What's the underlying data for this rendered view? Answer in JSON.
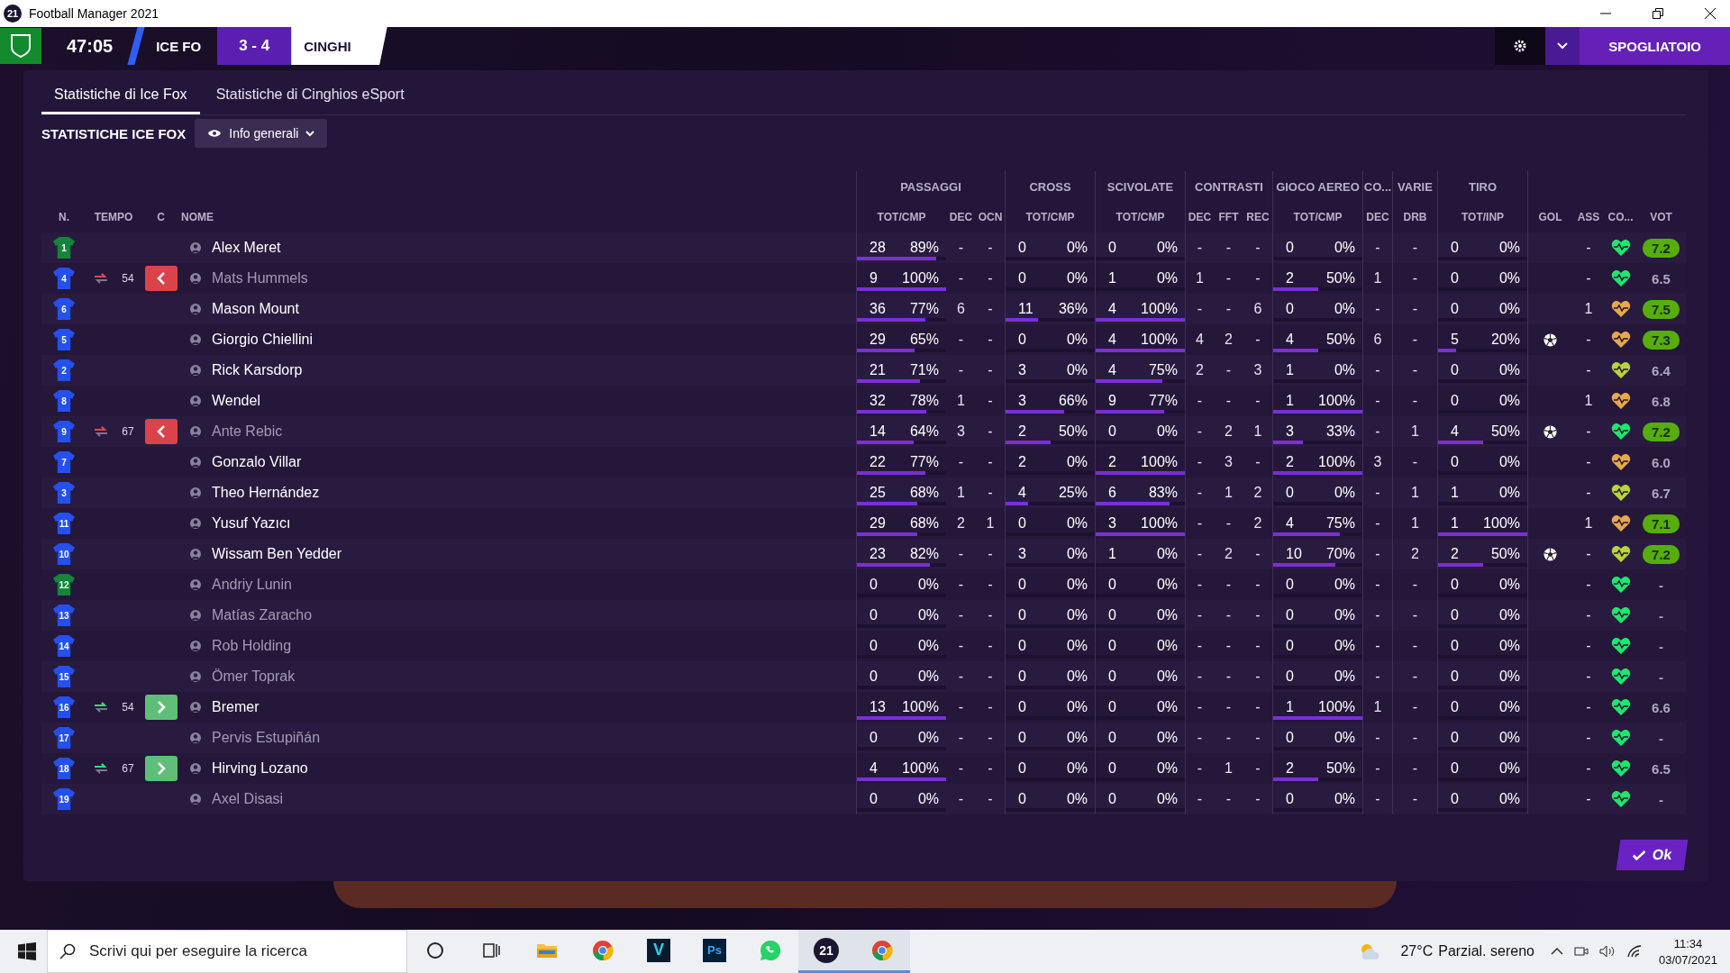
{
  "window": {
    "title": "Football Manager 2021",
    "logo": "21"
  },
  "match_bar": {
    "clock": "47:05",
    "home": "ICE FO",
    "score": "3 - 4",
    "away": "CINGHI",
    "button": "SPOGLIATOIO"
  },
  "tabs": [
    {
      "label": "Statistiche di Ice Fox",
      "selected": true
    },
    {
      "label": "Statistiche di Cinghios eSport",
      "selected": false
    }
  ],
  "section_title": "STATISTICHE ICE FOX",
  "view_dropdown": {
    "value": "Info generali"
  },
  "table": {
    "leading_columns": [
      "N.",
      "TEMPO",
      "C",
      "NOME"
    ],
    "groups": [
      {
        "label": "PASSAGGI",
        "columns": [
          "TOT/CMP",
          "DEC",
          "OCN"
        ]
      },
      {
        "label": "CROSS",
        "columns": [
          "TOT/CMP"
        ]
      },
      {
        "label": "SCIVOLATE",
        "columns": [
          "TOT/CMP"
        ]
      },
      {
        "label": "CONTRASTI",
        "columns": [
          "DEC",
          "FFT",
          "REC"
        ]
      },
      {
        "label": "GIOCO AEREO",
        "columns": [
          "TOT/CMP"
        ]
      },
      {
        "label": "CO...",
        "columns": [
          "DEC"
        ]
      },
      {
        "label": "VARIE",
        "columns": [
          "DRB"
        ]
      },
      {
        "label": "TIRO",
        "columns": [
          "TOT/INP"
        ]
      }
    ],
    "trailing_columns": [
      "GOL",
      "ASS",
      "CO...",
      "VOT"
    ],
    "rows": [
      {
        "num": "1",
        "goalkeeper": true,
        "name": "Alex Meret",
        "on_pitch": true,
        "pas": {
          "tot": "28",
          "pct": "89%",
          "level": 0.89
        },
        "pas_dec": "-",
        "ocn": "-",
        "crs": {
          "tot": "0",
          "pct": "0%",
          "level": 0
        },
        "sci": {
          "tot": "0",
          "pct": "0%",
          "level": 0
        },
        "ctr_dec": "-",
        "fft": "-",
        "rec": "-",
        "aer": {
          "tot": "0",
          "pct": "0%",
          "level": 0
        },
        "co_dec": "-",
        "drb": "-",
        "tiro": {
          "tot": "0",
          "pct": "0%",
          "level": 0
        },
        "goal": false,
        "ass": "-",
        "color": "#1ee86c",
        "vot": "7.2",
        "top": true
      },
      {
        "num": "4",
        "goalkeeper": false,
        "sub": {
          "kind": "out",
          "minute": "54"
        },
        "name": "Mats Hummels",
        "on_pitch": false,
        "pas": {
          "tot": "9",
          "pct": "100%",
          "level": 1
        },
        "pas_dec": "-",
        "ocn": "-",
        "crs": {
          "tot": "0",
          "pct": "0%",
          "level": 0
        },
        "sci": {
          "tot": "1",
          "pct": "0%",
          "level": 0
        },
        "ctr_dec": "1",
        "fft": "-",
        "rec": "-",
        "aer": {
          "tot": "2",
          "pct": "50%",
          "level": 0.5
        },
        "co_dec": "1",
        "drb": "-",
        "tiro": {
          "tot": "0",
          "pct": "0%",
          "level": 0
        },
        "goal": false,
        "ass": "-",
        "color": "#1ee86c",
        "vot": "6.5",
        "top": false
      },
      {
        "num": "6",
        "goalkeeper": false,
        "name": "Mason Mount",
        "on_pitch": true,
        "pas": {
          "tot": "36",
          "pct": "77%",
          "level": 0.77
        },
        "pas_dec": "6",
        "ocn": "-",
        "crs": {
          "tot": "11",
          "pct": "36%",
          "level": 0.36
        },
        "sci": {
          "tot": "4",
          "pct": "100%",
          "level": 1
        },
        "ctr_dec": "-",
        "fft": "-",
        "rec": "6",
        "aer": {
          "tot": "0",
          "pct": "0%",
          "level": 0
        },
        "co_dec": "-",
        "drb": "-",
        "tiro": {
          "tot": "0",
          "pct": "0%",
          "level": 0
        },
        "goal": false,
        "ass": "1",
        "color": "#e8a84a",
        "vot": "7.5",
        "top": true
      },
      {
        "num": "5",
        "goalkeeper": false,
        "name": "Giorgio Chiellini",
        "on_pitch": true,
        "pas": {
          "tot": "29",
          "pct": "65%",
          "level": 0.65
        },
        "pas_dec": "-",
        "ocn": "-",
        "crs": {
          "tot": "0",
          "pct": "0%",
          "level": 0
        },
        "sci": {
          "tot": "4",
          "pct": "100%",
          "level": 1
        },
        "ctr_dec": "4",
        "fft": "2",
        "rec": "-",
        "aer": {
          "tot": "4",
          "pct": "50%",
          "level": 0.5
        },
        "co_dec": "6",
        "drb": "-",
        "tiro": {
          "tot": "5",
          "pct": "20%",
          "level": 0.2
        },
        "goal": true,
        "ass": "-",
        "color": "#e8a84a",
        "vot": "7.3",
        "top": true
      },
      {
        "num": "2",
        "goalkeeper": false,
        "name": "Rick Karsdorp",
        "on_pitch": true,
        "pas": {
          "tot": "21",
          "pct": "71%",
          "level": 0.71
        },
        "pas_dec": "-",
        "ocn": "-",
        "crs": {
          "tot": "3",
          "pct": "0%",
          "level": 0
        },
        "sci": {
          "tot": "4",
          "pct": "75%",
          "level": 0.75
        },
        "ctr_dec": "2",
        "fft": "-",
        "rec": "3",
        "aer": {
          "tot": "1",
          "pct": "0%",
          "level": 0
        },
        "co_dec": "-",
        "drb": "-",
        "tiro": {
          "tot": "0",
          "pct": "0%",
          "level": 0
        },
        "goal": false,
        "ass": "-",
        "color": "#b8d43a",
        "vot": "6.4",
        "top": false
      },
      {
        "num": "8",
        "goalkeeper": false,
        "name": "Wendel",
        "on_pitch": true,
        "pas": {
          "tot": "32",
          "pct": "78%",
          "level": 0.78
        },
        "pas_dec": "1",
        "ocn": "-",
        "crs": {
          "tot": "3",
          "pct": "66%",
          "level": 0.66
        },
        "sci": {
          "tot": "9",
          "pct": "77%",
          "level": 0.77
        },
        "ctr_dec": "-",
        "fft": "-",
        "rec": "-",
        "aer": {
          "tot": "1",
          "pct": "100%",
          "level": 1
        },
        "co_dec": "-",
        "drb": "-",
        "tiro": {
          "tot": "0",
          "pct": "0%",
          "level": 0
        },
        "goal": false,
        "ass": "1",
        "color": "#e8a84a",
        "vot": "6.8",
        "top": false
      },
      {
        "num": "9",
        "goalkeeper": false,
        "sub": {
          "kind": "out",
          "minute": "67"
        },
        "name": "Ante Rebic",
        "on_pitch": false,
        "pas": {
          "tot": "14",
          "pct": "64%",
          "level": 0.64
        },
        "pas_dec": "3",
        "ocn": "-",
        "crs": {
          "tot": "2",
          "pct": "50%",
          "level": 0.5
        },
        "sci": {
          "tot": "0",
          "pct": "0%",
          "level": 0
        },
        "ctr_dec": "-",
        "fft": "2",
        "rec": "1",
        "aer": {
          "tot": "3",
          "pct": "33%",
          "level": 0.33
        },
        "co_dec": "-",
        "drb": "1",
        "tiro": {
          "tot": "4",
          "pct": "50%",
          "level": 0.5
        },
        "goal": true,
        "ass": "-",
        "color": "#1ee86c",
        "vot": "7.2",
        "top": true
      },
      {
        "num": "7",
        "goalkeeper": false,
        "name": "Gonzalo Villar",
        "on_pitch": true,
        "pas": {
          "tot": "22",
          "pct": "77%",
          "level": 0.77
        },
        "pas_dec": "-",
        "ocn": "-",
        "crs": {
          "tot": "2",
          "pct": "0%",
          "level": 0
        },
        "sci": {
          "tot": "2",
          "pct": "100%",
          "level": 1
        },
        "ctr_dec": "-",
        "fft": "3",
        "rec": "-",
        "aer": {
          "tot": "2",
          "pct": "100%",
          "level": 1
        },
        "co_dec": "3",
        "drb": "-",
        "tiro": {
          "tot": "0",
          "pct": "0%",
          "level": 0
        },
        "goal": false,
        "ass": "-",
        "color": "#e8a84a",
        "vot": "6.0",
        "top": false
      },
      {
        "num": "3",
        "goalkeeper": false,
        "name": "Theo Hernández",
        "on_pitch": true,
        "pas": {
          "tot": "25",
          "pct": "68%",
          "level": 0.68
        },
        "pas_dec": "1",
        "ocn": "-",
        "crs": {
          "tot": "4",
          "pct": "25%",
          "level": 0.25
        },
        "sci": {
          "tot": "6",
          "pct": "83%",
          "level": 0.83
        },
        "ctr_dec": "-",
        "fft": "1",
        "rec": "2",
        "aer": {
          "tot": "0",
          "pct": "0%",
          "level": 0
        },
        "co_dec": "-",
        "drb": "1",
        "tiro": {
          "tot": "1",
          "pct": "0%",
          "level": 0
        },
        "goal": false,
        "ass": "-",
        "color": "#b8d43a",
        "vot": "6.7",
        "top": false
      },
      {
        "num": "11",
        "goalkeeper": false,
        "name": "Yusuf Yazıcı",
        "on_pitch": true,
        "pas": {
          "tot": "29",
          "pct": "68%",
          "level": 0.68
        },
        "pas_dec": "2",
        "ocn": "1",
        "crs": {
          "tot": "0",
          "pct": "0%",
          "level": 0
        },
        "sci": {
          "tot": "3",
          "pct": "100%",
          "level": 1
        },
        "ctr_dec": "-",
        "fft": "-",
        "rec": "2",
        "aer": {
          "tot": "4",
          "pct": "75%",
          "level": 0.75
        },
        "co_dec": "-",
        "drb": "1",
        "tiro": {
          "tot": "1",
          "pct": "100%",
          "level": 1
        },
        "goal": false,
        "ass": "1",
        "color": "#e8a84a",
        "vot": "7.1",
        "top": true
      },
      {
        "num": "10",
        "goalkeeper": false,
        "name": "Wissam Ben Yedder",
        "on_pitch": true,
        "pas": {
          "tot": "23",
          "pct": "82%",
          "level": 0.82
        },
        "pas_dec": "-",
        "ocn": "-",
        "crs": {
          "tot": "3",
          "pct": "0%",
          "level": 0
        },
        "sci": {
          "tot": "1",
          "pct": "0%",
          "level": 0
        },
        "ctr_dec": "-",
        "fft": "2",
        "rec": "-",
        "aer": {
          "tot": "10",
          "pct": "70%",
          "level": 0.7
        },
        "co_dec": "-",
        "drb": "2",
        "tiro": {
          "tot": "2",
          "pct": "50%",
          "level": 0.5
        },
        "goal": true,
        "ass": "-",
        "color": "#b8d43a",
        "vot": "7.2",
        "top": true
      },
      {
        "num": "12",
        "goalkeeper": true,
        "name": "Andriy Lunin",
        "on_pitch": false,
        "pas": {
          "tot": "0",
          "pct": "0%",
          "level": 0
        },
        "pas_dec": "-",
        "ocn": "-",
        "crs": {
          "tot": "0",
          "pct": "0%",
          "level": 0
        },
        "sci": {
          "tot": "0",
          "pct": "0%",
          "level": 0
        },
        "ctr_dec": "-",
        "fft": "-",
        "rec": "-",
        "aer": {
          "tot": "0",
          "pct": "0%",
          "level": 0
        },
        "co_dec": "-",
        "drb": "-",
        "tiro": {
          "tot": "0",
          "pct": "0%",
          "level": 0
        },
        "goal": false,
        "ass": "-",
        "color": "#1ee86c",
        "vot": "-",
        "top": false
      },
      {
        "num": "13",
        "goalkeeper": false,
        "name": "Matías Zaracho",
        "on_pitch": false,
        "pas": {
          "tot": "0",
          "pct": "0%",
          "level": 0
        },
        "pas_dec": "-",
        "ocn": "-",
        "crs": {
          "tot": "0",
          "pct": "0%",
          "level": 0
        },
        "sci": {
          "tot": "0",
          "pct": "0%",
          "level": 0
        },
        "ctr_dec": "-",
        "fft": "-",
        "rec": "-",
        "aer": {
          "tot": "0",
          "pct": "0%",
          "level": 0
        },
        "co_dec": "-",
        "drb": "-",
        "tiro": {
          "tot": "0",
          "pct": "0%",
          "level": 0
        },
        "goal": false,
        "ass": "-",
        "color": "#1ee86c",
        "vot": "-",
        "top": false
      },
      {
        "num": "14",
        "goalkeeper": false,
        "name": "Rob Holding",
        "on_pitch": false,
        "pas": {
          "tot": "0",
          "pct": "0%",
          "level": 0
        },
        "pas_dec": "-",
        "ocn": "-",
        "crs": {
          "tot": "0",
          "pct": "0%",
          "level": 0
        },
        "sci": {
          "tot": "0",
          "pct": "0%",
          "level": 0
        },
        "ctr_dec": "-",
        "fft": "-",
        "rec": "-",
        "aer": {
          "tot": "0",
          "pct": "0%",
          "level": 0
        },
        "co_dec": "-",
        "drb": "-",
        "tiro": {
          "tot": "0",
          "pct": "0%",
          "level": 0
        },
        "goal": false,
        "ass": "-",
        "color": "#1ee86c",
        "vot": "-",
        "top": false
      },
      {
        "num": "15",
        "goalkeeper": false,
        "name": "Ömer Toprak",
        "on_pitch": false,
        "pas": {
          "tot": "0",
          "pct": "0%",
          "level": 0
        },
        "pas_dec": "-",
        "ocn": "-",
        "crs": {
          "tot": "0",
          "pct": "0%",
          "level": 0
        },
        "sci": {
          "tot": "0",
          "pct": "0%",
          "level": 0
        },
        "ctr_dec": "-",
        "fft": "-",
        "rec": "-",
        "aer": {
          "tot": "0",
          "pct": "0%",
          "level": 0
        },
        "co_dec": "-",
        "drb": "-",
        "tiro": {
          "tot": "0",
          "pct": "0%",
          "level": 0
        },
        "goal": false,
        "ass": "-",
        "color": "#1ee86c",
        "vot": "-",
        "top": false
      },
      {
        "num": "16",
        "goalkeeper": false,
        "sub": {
          "kind": "in",
          "minute": "54"
        },
        "name": "Bremer",
        "on_pitch": true,
        "pas": {
          "tot": "13",
          "pct": "100%",
          "level": 1
        },
        "pas_dec": "-",
        "ocn": "-",
        "crs": {
          "tot": "0",
          "pct": "0%",
          "level": 0
        },
        "sci": {
          "tot": "0",
          "pct": "0%",
          "level": 0
        },
        "ctr_dec": "-",
        "fft": "-",
        "rec": "-",
        "aer": {
          "tot": "1",
          "pct": "100%",
          "level": 1
        },
        "co_dec": "1",
        "drb": "-",
        "tiro": {
          "tot": "0",
          "pct": "0%",
          "level": 0
        },
        "goal": false,
        "ass": "-",
        "color": "#1ee86c",
        "vot": "6.6",
        "top": false
      },
      {
        "num": "17",
        "goalkeeper": false,
        "name": "Pervis Estupiñán",
        "on_pitch": false,
        "pas": {
          "tot": "0",
          "pct": "0%",
          "level": 0
        },
        "pas_dec": "-",
        "ocn": "-",
        "crs": {
          "tot": "0",
          "pct": "0%",
          "level": 0
        },
        "sci": {
          "tot": "0",
          "pct": "0%",
          "level": 0
        },
        "ctr_dec": "-",
        "fft": "-",
        "rec": "-",
        "aer": {
          "tot": "0",
          "pct": "0%",
          "level": 0
        },
        "co_dec": "-",
        "drb": "-",
        "tiro": {
          "tot": "0",
          "pct": "0%",
          "level": 0
        },
        "goal": false,
        "ass": "-",
        "color": "#1ee86c",
        "vot": "-",
        "top": false
      },
      {
        "num": "18",
        "goalkeeper": false,
        "sub": {
          "kind": "in",
          "minute": "67"
        },
        "name": "Hirving Lozano",
        "on_pitch": true,
        "pas": {
          "tot": "4",
          "pct": "100%",
          "level": 1
        },
        "pas_dec": "-",
        "ocn": "-",
        "crs": {
          "tot": "0",
          "pct": "0%",
          "level": 0
        },
        "sci": {
          "tot": "0",
          "pct": "0%",
          "level": 0
        },
        "ctr_dec": "-",
        "fft": "1",
        "rec": "-",
        "aer": {
          "tot": "2",
          "pct": "50%",
          "level": 0.5
        },
        "co_dec": "-",
        "drb": "-",
        "tiro": {
          "tot": "0",
          "pct": "0%",
          "level": 0
        },
        "goal": false,
        "ass": "-",
        "color": "#1ee86c",
        "vot": "6.5",
        "top": false
      },
      {
        "num": "19",
        "goalkeeper": false,
        "name": "Axel Disasi",
        "on_pitch": false,
        "pas": {
          "tot": "0",
          "pct": "0%",
          "level": 0
        },
        "pas_dec": "-",
        "ocn": "-",
        "crs": {
          "tot": "0",
          "pct": "0%",
          "level": 0
        },
        "sci": {
          "tot": "0",
          "pct": "0%",
          "level": 0
        },
        "ctr_dec": "-",
        "fft": "-",
        "rec": "-",
        "aer": {
          "tot": "0",
          "pct": "0%",
          "level": 0
        },
        "co_dec": "-",
        "drb": "-",
        "tiro": {
          "tot": "0",
          "pct": "0%",
          "level": 0
        },
        "goal": false,
        "ass": "-",
        "color": "#1ee86c",
        "vot": "-",
        "top": false
      }
    ]
  },
  "ok_button": "Ok",
  "taskbar": {
    "search": {
      "placeholder": "Scrivi qui per eseguire la ricerca"
    },
    "apps": [
      {
        "kind": "cortana",
        "active": false
      },
      {
        "kind": "taskview",
        "active": false
      },
      {
        "kind": "folder",
        "active": false
      },
      {
        "kind": "chrome",
        "active": false
      },
      {
        "kind": "vegas",
        "label": "V",
        "active": false
      },
      {
        "kind": "photoshop",
        "label": "Ps",
        "active": false
      },
      {
        "kind": "whatsapp",
        "active": false
      },
      {
        "kind": "fm",
        "label": "21",
        "active": true
      },
      {
        "kind": "chrome",
        "active": true
      }
    ],
    "temperature": "27°C",
    "weather": "Parzial. sereno",
    "time": "11:34",
    "date": "03/07/2021"
  }
}
